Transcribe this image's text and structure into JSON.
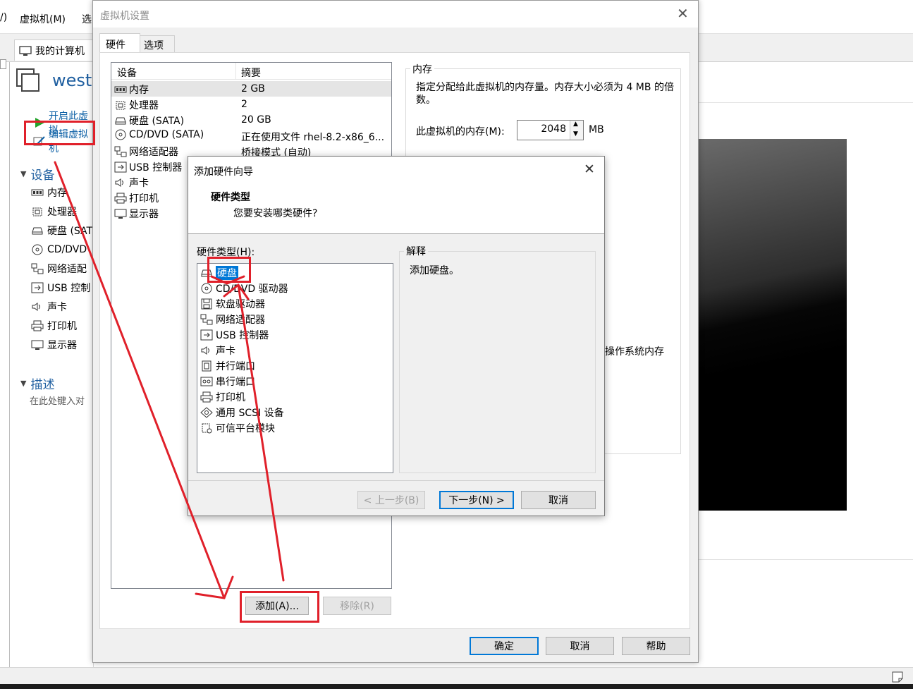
{
  "background_app": {
    "menu": {
      "view_partial": "/)",
      "vm_menu": "虚拟机(M)",
      "tab_partial": "选"
    },
    "tab": {
      "label": "我的计算机"
    },
    "vm_title_partial": "westo",
    "actions": {
      "power_on": "开启此虚拟",
      "edit_settings": "编辑虚拟机"
    },
    "devices_header": "设备",
    "devices": [
      "内存",
      "处理器",
      "硬盘 (SAT",
      "CD/DVD",
      "网络适配",
      "USB 控制",
      "声卡",
      "打印机",
      "显示器"
    ],
    "description_header": "描述",
    "description_placeholder": "在此处键入对"
  },
  "settings_dialog": {
    "title": "虚拟机设置",
    "tabs": [
      "硬件",
      "选项"
    ],
    "table_headers": {
      "device": "设备",
      "summary": "摘要"
    },
    "devices": [
      {
        "name": "内存",
        "summary": "2 GB",
        "icon": "memory-icon"
      },
      {
        "name": "处理器",
        "summary": "2",
        "icon": "cpu-icon"
      },
      {
        "name": "硬盘 (SATA)",
        "summary": "20 GB",
        "icon": "harddisk-icon"
      },
      {
        "name": "CD/DVD (SATA)",
        "summary": "正在使用文件 rhel-8.2-x86_6...",
        "icon": "cd-icon"
      },
      {
        "name": "网络适配器",
        "summary": "桥接模式 (自动)",
        "icon": "network-icon"
      },
      {
        "name": "USB 控制器",
        "summary": "",
        "icon": "usb-icon"
      },
      {
        "name": "声卡",
        "summary": "",
        "icon": "sound-icon"
      },
      {
        "name": "打印机",
        "summary": "",
        "icon": "printer-icon"
      },
      {
        "name": "显示器",
        "summary": "",
        "icon": "display-icon"
      }
    ],
    "memory_group": {
      "title": "内存",
      "description": "指定分配给此虚拟机的内存量。内存大小必须为 4 MB 的倍数。",
      "label": "此虚拟机的内存(M):",
      "value": "2048",
      "unit": "MB",
      "hidden_text_partial": "操作系统内存"
    },
    "buttons": {
      "add": "添加(A)...",
      "remove": "移除(R)",
      "ok": "确定",
      "cancel": "取消",
      "help": "帮助"
    }
  },
  "wizard": {
    "title": "添加硬件向导",
    "heading": "硬件类型",
    "subheading": "您要安装哪类硬件?",
    "list_label": "硬件类型(H):",
    "items": [
      {
        "label": "硬盘",
        "icon": "harddisk-icon"
      },
      {
        "label": "CD/DVD 驱动器",
        "icon": "cd-icon"
      },
      {
        "label": "软盘驱动器",
        "icon": "floppy-icon"
      },
      {
        "label": "网络适配器",
        "icon": "network-icon"
      },
      {
        "label": "USB 控制器",
        "icon": "usb-icon"
      },
      {
        "label": "声卡",
        "icon": "sound-icon"
      },
      {
        "label": "并行端口",
        "icon": "parallel-port-icon"
      },
      {
        "label": "串行端口",
        "icon": "serial-port-icon"
      },
      {
        "label": "打印机",
        "icon": "printer-icon"
      },
      {
        "label": "通用 SCSI 设备",
        "icon": "scsi-icon"
      },
      {
        "label": "可信平台模块",
        "icon": "tpm-icon"
      }
    ],
    "explanation_label": "解释",
    "explanation_text": "添加硬盘。",
    "buttons": {
      "back": "< 上一步(B)",
      "next": "下一步(N) >",
      "cancel": "取消"
    }
  },
  "colors": {
    "highlight": "#e0202a",
    "selection": "#0078d7",
    "link": "#0b5fa5"
  }
}
